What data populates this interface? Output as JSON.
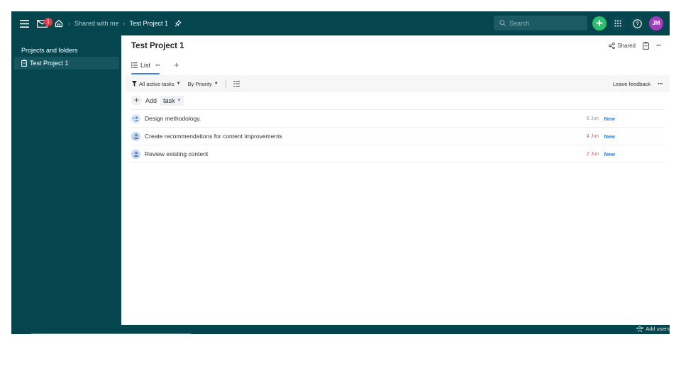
{
  "topbar": {
    "mail_badge_count": "1",
    "breadcrumb": [
      "Shared with me",
      "Test Project 1"
    ],
    "search_placeholder": "Search",
    "avatar_initials": "JM",
    "colors": {
      "background": "#05454e",
      "new_button": "#2bc06b",
      "avatar": "#a33cbd",
      "badge": "#e53844"
    }
  },
  "sidebar": {
    "title": "Projects and folders",
    "items": [
      {
        "label": "Test Project 1",
        "icon": "clipboard-icon",
        "selected": true
      }
    ]
  },
  "main": {
    "project_title": "Test Project 1",
    "shared_label": "Shared",
    "tabs": [
      {
        "label": "List",
        "active": true
      }
    ],
    "toolbar": {
      "filter_label": "All active tasks",
      "group_label": "By Priority",
      "feedback_label": "Leave feedback"
    },
    "add_row": {
      "add_label": "Add",
      "type_label": "task"
    },
    "tasks": [
      {
        "title": "Design methodology.",
        "date": "8 Jun",
        "date_color": "#999999",
        "status": "New",
        "icon": "add-assignee-icon"
      },
      {
        "title": "Create recommendations for content improvements",
        "date": "4 Jun",
        "date_color": "#e8505b",
        "status": "New",
        "icon": "assignee-avatar-icon"
      },
      {
        "title": "Review existing content",
        "date": "2 Jun",
        "date_color": "#e8505b",
        "status": "New",
        "icon": "assignee-avatar-icon"
      }
    ]
  },
  "bottombar": {
    "add_users_label": "Add users"
  }
}
